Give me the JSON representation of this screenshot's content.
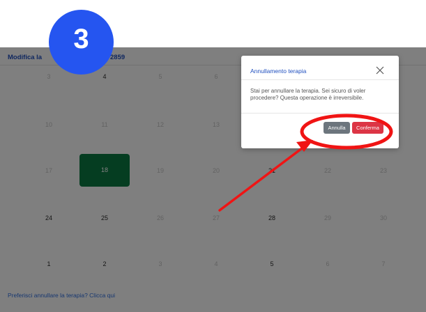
{
  "app": {
    "title_visible_left": "Modifica la",
    "title_visible_right": "2859",
    "link_cancel": "Preferisci annullare la terapia? Clicca qui"
  },
  "calendar": {
    "row1": [
      "3",
      "4",
      "5",
      "6"
    ],
    "row2": [
      "10",
      "11",
      "12",
      "13"
    ],
    "row3": [
      "17",
      "18",
      "19",
      "20",
      "21",
      "22",
      "23"
    ],
    "row4": [
      "24",
      "25",
      "26",
      "27",
      "28",
      "29",
      "30"
    ],
    "row5": [
      "1",
      "2",
      "3",
      "4",
      "5",
      "6",
      "7"
    ],
    "selected_day": "18"
  },
  "modal": {
    "title": "Annullamento terapia",
    "body": "Stai per annullare la terapia. Sei sicuro di voler procedere? Questa operazione è irreversibile.",
    "cancel_label": "Annulla",
    "confirm_label": "Conferma"
  },
  "annotation": {
    "step_number": "3"
  },
  "colors": {
    "accent_blue": "#2555f0",
    "selected_green": "#0a7a43",
    "danger_red": "#dc3545",
    "annotation_red": "#f01414"
  },
  "icons": [
    "close-icon"
  ]
}
